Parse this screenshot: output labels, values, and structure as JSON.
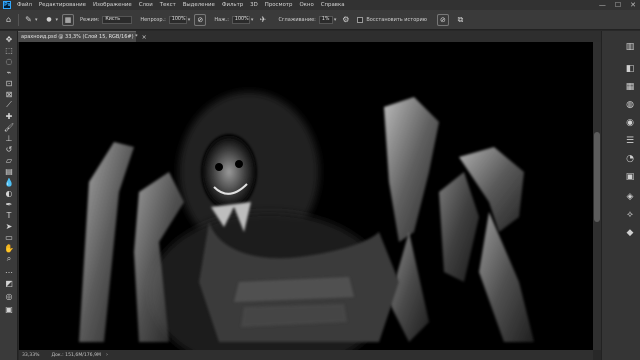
{
  "app": {
    "logo": "Ps"
  },
  "menu": [
    "Файл",
    "Редактирование",
    "Изображение",
    "Слои",
    "Текст",
    "Выделение",
    "Фильтр",
    "3D",
    "Просмотр",
    "Окно",
    "Справка"
  ],
  "window_controls": {
    "minimize": "—",
    "maximize": "☐",
    "close": "✕"
  },
  "options": {
    "mode_label": "Режим:",
    "mode_value": "Кисть",
    "opacity_label": "Непрозр.:",
    "opacity_value": "100%",
    "pressure_label": "Наж.:",
    "pressure_value": "100%",
    "smoothing_label": "Сглаживание:",
    "smoothing_value": "1%",
    "restore_history_label": "Восстановить историю"
  },
  "document_tab": {
    "title": "арахноид.psd @ 33,3% (Слой 15, RGB/16#) *",
    "close": "×"
  },
  "status": {
    "zoom": "33,33%",
    "doc_info": "Док.: 151,6M/176,9M"
  },
  "icons": {
    "tools": [
      "move-icon",
      "marquee-icon",
      "lasso-icon",
      "quick-select-icon",
      "crop-icon",
      "frame-icon",
      "eyedropper-icon",
      "spot-heal-icon",
      "brush-icon",
      "clone-stamp-icon",
      "history-brush-icon",
      "eraser-icon",
      "gradient-icon",
      "blur-icon",
      "dodge-icon",
      "pen-icon",
      "type-icon",
      "path-select-icon",
      "rectangle-icon",
      "hand-icon",
      "zoom-icon",
      "more-tools-icon",
      "colors-icon",
      "quick-mask-icon",
      "screen-mode-icon"
    ],
    "panels": [
      "history-panel-icon",
      "color-panel-icon",
      "swatches-panel-icon",
      "brushes-panel-icon",
      "adjustments-panel-icon",
      "properties-panel-icon",
      "learn-panel-icon",
      "libraries-panel-icon",
      "channels-panel-icon",
      "paths-panel-icon",
      "layers-panel-icon"
    ]
  },
  "colors": {
    "accent": "#31a8ff",
    "chrome_dark": "#323232",
    "chrome_mid": "#3a3a3a",
    "canvas": "#000000"
  }
}
